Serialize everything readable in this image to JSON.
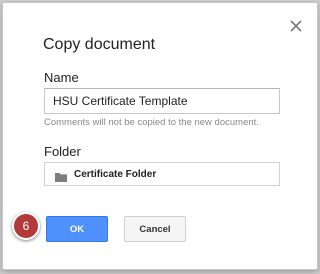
{
  "dialog": {
    "title": "Copy document",
    "close_icon": "close-icon",
    "name_label": "Name",
    "name_value": "HSU Certificate Template",
    "comments_hint": "Comments will not be copied to the new document.",
    "folder_label": "Folder",
    "folder_value": "Certificate Folder",
    "folder_icon": "folder-icon",
    "ok_label": "OK",
    "cancel_label": "Cancel"
  },
  "annotation": {
    "step_number": "6"
  },
  "colors": {
    "primary_button": "#4d90fe",
    "step_badge": "#b23a3a"
  }
}
